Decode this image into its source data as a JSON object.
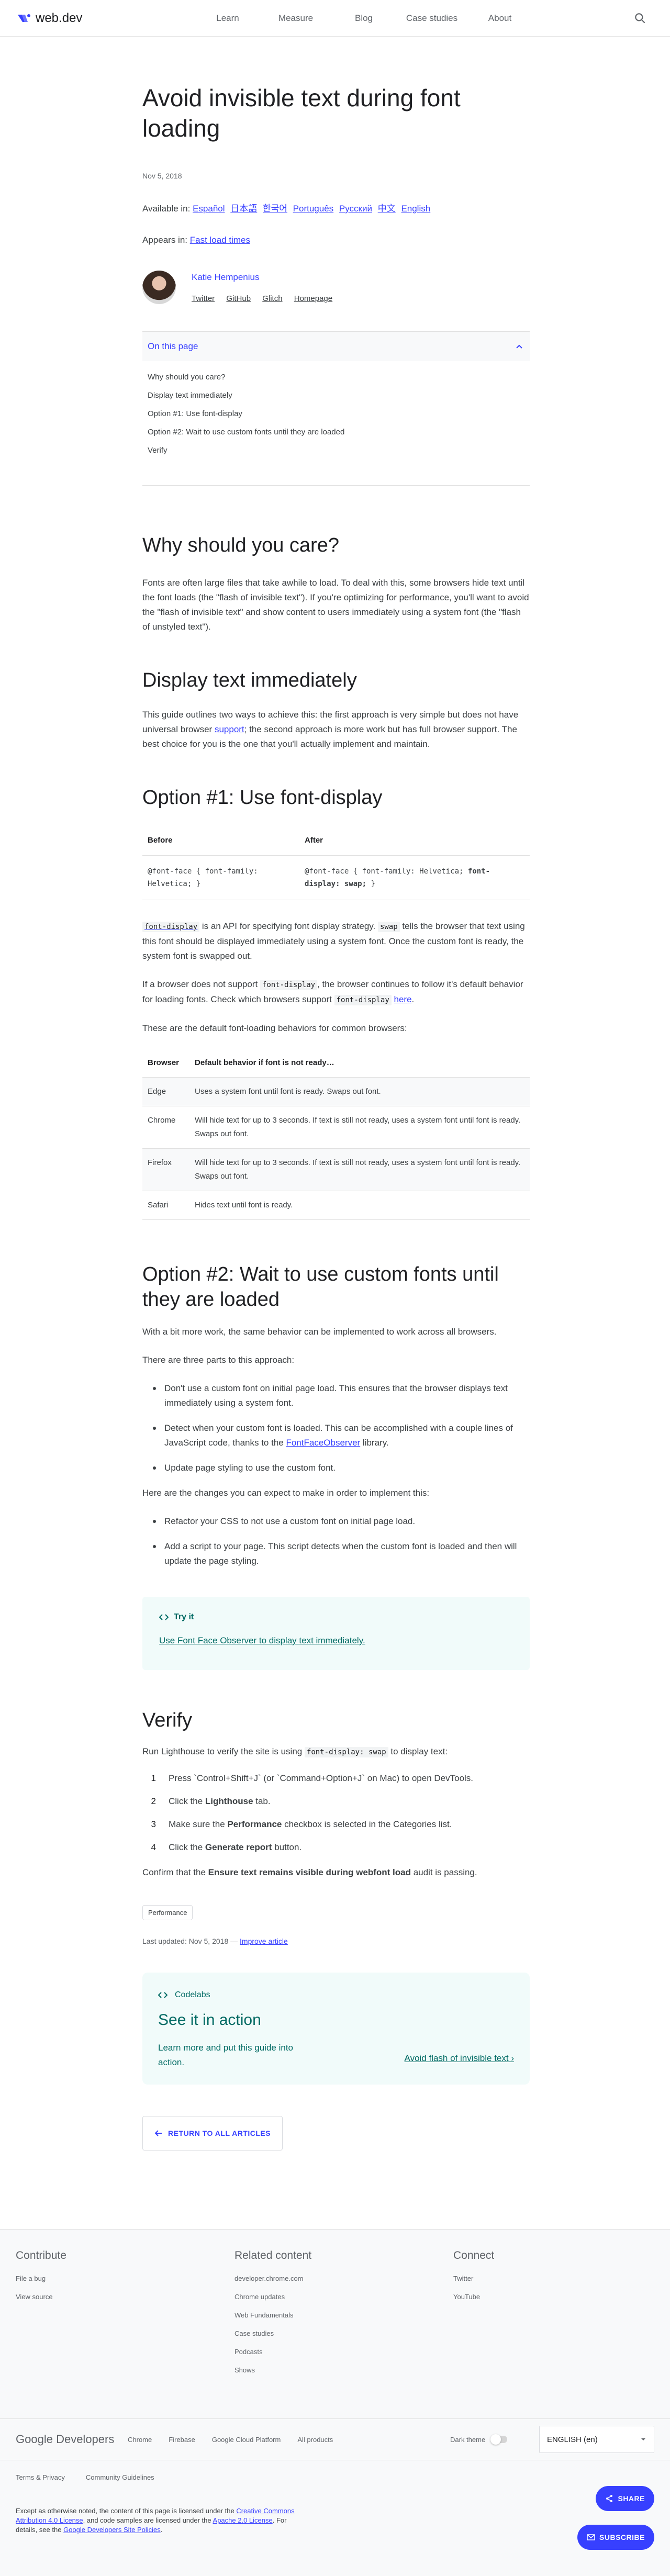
{
  "header": {
    "logo_text": "web.dev",
    "nav": [
      "Learn",
      "Measure",
      "Blog",
      "Case studies",
      "About"
    ]
  },
  "article": {
    "title": "Avoid invisible text during font loading",
    "date": "Nov 5, 2018",
    "available_label": "Available in:",
    "languages": [
      "Español",
      "日本語",
      "한국어",
      "Português",
      "Русский",
      "中文",
      "English"
    ],
    "appears_label": "Appears in:",
    "appears_link": "Fast load times",
    "author": {
      "name": "Katie Hempenius",
      "links": [
        "Twitter",
        "GitHub",
        "Glitch",
        "Homepage"
      ]
    },
    "toc": {
      "title": "On this page",
      "items": [
        "Why should you care?",
        "Display text immediately",
        "Option #1: Use font-display",
        "Option #2: Wait to use custom fonts until they are loaded",
        "Verify"
      ]
    },
    "s1": {
      "heading": "Why should you care?",
      "text": "Fonts are often large files that take awhile to load. To deal with this, some browsers hide text until the font loads (the \"flash of invisible text\"). If you're optimizing for performance, you'll want to avoid the \"flash of invisible text\" and show content to users immediately using a system font (the \"flash of unstyled text\")."
    },
    "s2": {
      "heading": "Display text immediately",
      "text_a": "This guide outlines two ways to achieve this: the first approach is very simple but does not have universal browser ",
      "link": "support",
      "text_b": "; the second approach is more work but has full browser support. The best choice for you is the one that you'll actually implement and maintain."
    },
    "s3": {
      "heading": "Option #1: Use font-display",
      "code_headers": [
        "Before",
        "After"
      ],
      "code_before": "@font-face { font-family: Helvetica; }",
      "code_after_a": "@font-face { font-family: Helvetica; ",
      "code_after_b": "font-display: swap;",
      "code_after_c": " }",
      "p1_code1": "font-display",
      "p1_a": " is an API for specifying font display strategy. ",
      "p1_code2": "swap",
      "p1_b": " tells the browser that text using this font should be displayed immediately using a system font. Once the custom font is ready, the system font is swapped out.",
      "p2_a": "If a browser does not support ",
      "p2_code1": "font-display",
      "p2_b": ", the browser continues to follow it's default behavior for loading fonts. Check which browsers support ",
      "p2_code2": "font-display",
      "p2_link": "here",
      "p2_c": ".",
      "p3": "These are the default font-loading behaviors for common browsers:",
      "table_headers": [
        "Browser",
        "Default behavior if font is not ready…"
      ],
      "rows": [
        {
          "browser": "Edge",
          "behavior": "Uses a system font until font is ready. Swaps out font."
        },
        {
          "browser": "Chrome",
          "behavior": "Will hide text for up to 3 seconds. If text is still not ready, uses a system font until font is ready. Swaps out font."
        },
        {
          "browser": "Firefox",
          "behavior": "Will hide text for up to 3 seconds. If text is still not ready, uses a system font until font is ready. Swaps out font."
        },
        {
          "browser": "Safari",
          "behavior": "Hides text until font is ready."
        }
      ]
    },
    "s4": {
      "heading": "Option #2: Wait to use custom fonts until they are loaded",
      "p1": "With a bit more work, the same behavior can be implemented to work across all browsers.",
      "p2": "There are three parts to this approach:",
      "b1": "Don't use a custom font on initial page load. This ensures that the browser displays text immediately using a system font.",
      "b2_a": "Detect when your custom font is loaded. This can be accomplished with a couple lines of JavaScript code, thanks to the ",
      "b2_link": "FontFaceObserver",
      "b2_b": " library.",
      "b3": "Update page styling to use the custom font.",
      "p3": "Here are the changes you can expect to make in order to implement this:",
      "c1": "Refactor your CSS to not use a custom font on initial page load.",
      "c2": "Add a script to your page. This script detects when the custom font is loaded and then will update the page styling.",
      "tryit_label": "Try it",
      "tryit_link": "Use Font Face Observer to display text immediately."
    },
    "s5": {
      "heading": "Verify",
      "intro_a": "Run Lighthouse to verify the site is using ",
      "intro_code": "font-display: swap",
      "intro_b": " to display text:",
      "steps": [
        {
          "n": "1",
          "a": "Press `Control+Shift+J` (or `Command+Option+J` on Mac) to open DevTools.",
          "bold": "",
          "b": ""
        },
        {
          "n": "2",
          "a": "Click the ",
          "bold": "Lighthouse",
          "b": " tab."
        },
        {
          "n": "3",
          "a": "Make sure the ",
          "bold": "Performance",
          "b": " checkbox is selected in the Categories list."
        },
        {
          "n": "4",
          "a": "Click the ",
          "bold": "Generate report",
          "b": " button."
        }
      ],
      "confirm_a": "Confirm that the ",
      "confirm_bold": "Ensure text remains visible during webfont load",
      "confirm_b": " audit is passing."
    },
    "tag": "Performance",
    "updated_a": "Last updated: Nov 5, 2018 — ",
    "updated_link": "Improve article",
    "codelab": {
      "tag": "Codelabs",
      "title": "See it in action",
      "text": "Learn more and put this guide into action.",
      "link": "Avoid flash of invisible text"
    },
    "return": "RETURN TO ALL ARTICLES"
  },
  "footer": {
    "contribute": {
      "title": "Contribute",
      "items": [
        "File a bug",
        "View source"
      ]
    },
    "related": {
      "title": "Related content",
      "items": [
        "developer.chrome.com",
        "Chrome updates",
        "Web Fundamentals",
        "Case studies",
        "Podcasts",
        "Shows"
      ]
    },
    "connect": {
      "title": "Connect",
      "items": [
        "Twitter",
        "YouTube"
      ]
    },
    "brand_a": "Google",
    "brand_b": "Developers",
    "links": [
      "Chrome",
      "Firebase",
      "Google Cloud Platform",
      "All products"
    ],
    "dark_theme": "Dark theme",
    "language": "ENGLISH (en)",
    "legal": [
      "Terms & Privacy",
      "Community Guidelines"
    ],
    "license_a": "Except as otherwise noted, the content of this page is licensed under the ",
    "license_link1": "Creative Commons Attribution 4.0 License",
    "license_b": ", and code samples are licensed under the ",
    "license_link2": "Apache 2.0 License",
    "license_c": ". For details, see the ",
    "license_link3": "Google Developers Site Policies",
    "license_d": ".",
    "share": "SHARE",
    "subscribe": "SUBSCRIBE"
  },
  "colors": {
    "accent": "#3740ff",
    "teal": "#006a63",
    "text": "#3c4043"
  }
}
